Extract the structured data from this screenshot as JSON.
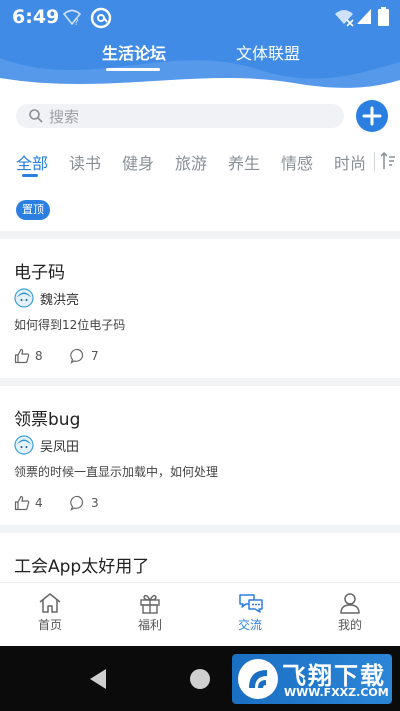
{
  "status_bar": {
    "time": "6:49"
  },
  "header": {
    "tabs": [
      {
        "label": "生活论坛",
        "active": true
      },
      {
        "label": "文体联盟",
        "active": false
      }
    ]
  },
  "search": {
    "placeholder": "搜索"
  },
  "categories": [
    "全部",
    "读书",
    "健身",
    "旅游",
    "养生",
    "情感",
    "时尚"
  ],
  "active_category": "全部",
  "pinned_badge": "置顶",
  "posts": [
    {
      "title": "电子码",
      "author": "魏洪亮",
      "excerpt": "如何得到12位电子码",
      "likes": "8",
      "comments": "7"
    },
    {
      "title": "领票bug",
      "author": "吴凤田",
      "excerpt": "领票的时候一直显示加载中，如何处理",
      "likes": "4",
      "comments": "3"
    },
    {
      "title": "工会App太好用了"
    }
  ],
  "bottom_nav": [
    {
      "label": "首页",
      "icon": "home-icon"
    },
    {
      "label": "福利",
      "icon": "gift-icon"
    },
    {
      "label": "交流",
      "icon": "chat-icon",
      "active": true
    },
    {
      "label": "我的",
      "icon": "profile-icon"
    }
  ],
  "watermark": {
    "title": "飞翔下载",
    "url": "WWW.FXXZ.COM"
  },
  "colors": {
    "header": "#3f8be6",
    "accent": "#2b7fe0"
  }
}
